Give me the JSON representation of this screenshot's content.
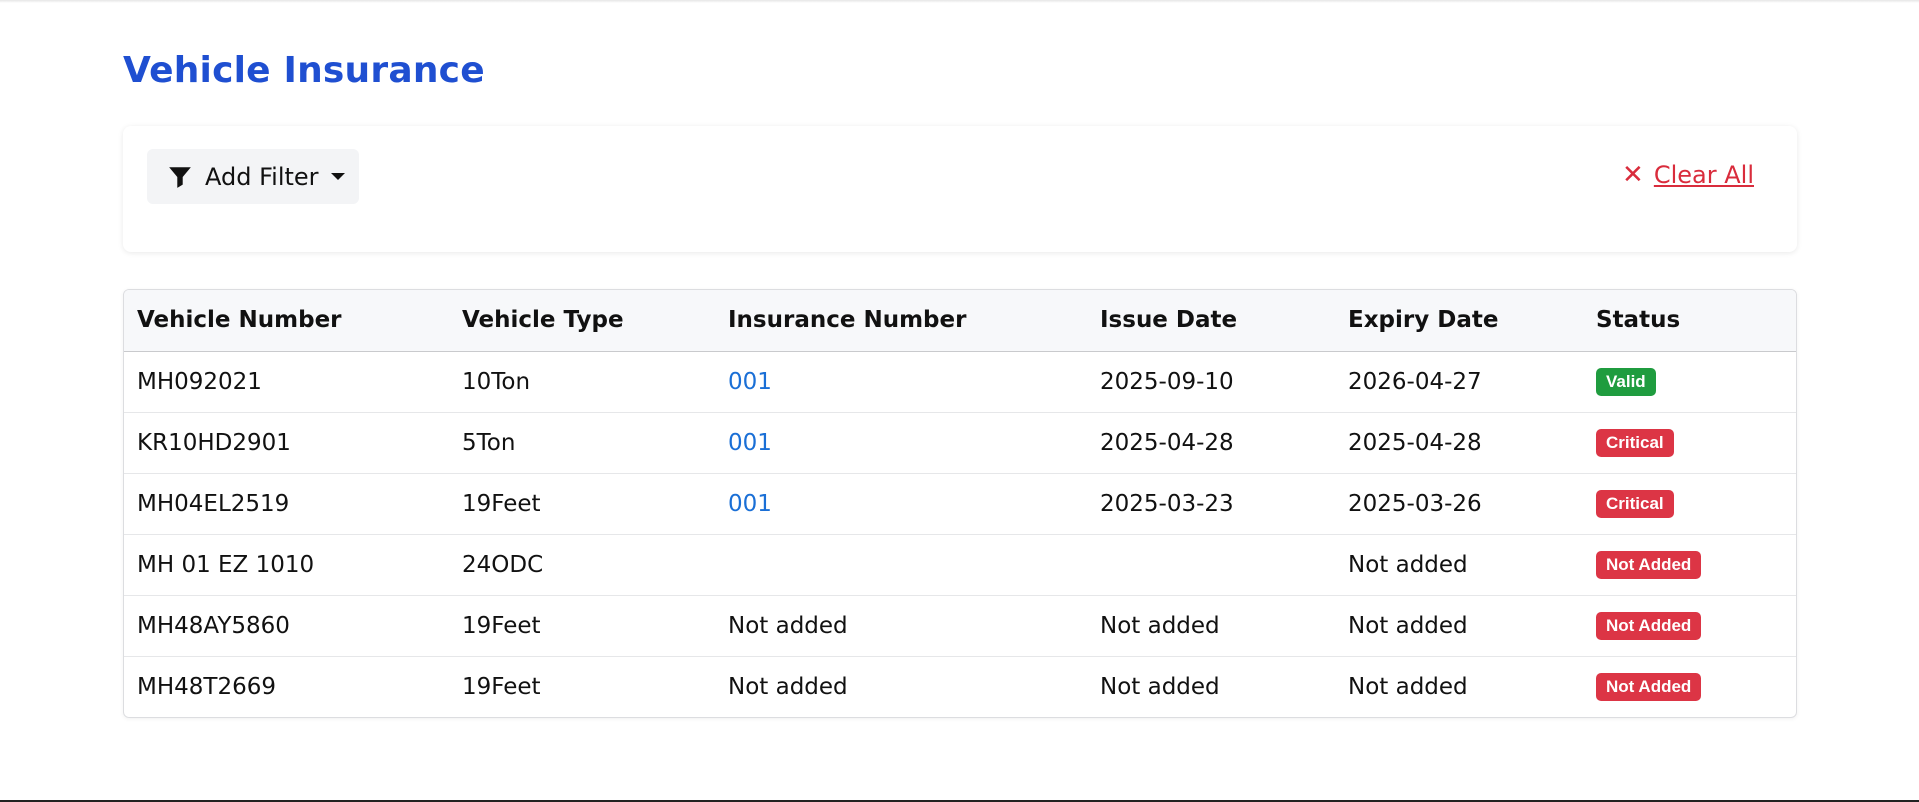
{
  "page": {
    "title": "Vehicle Insurance"
  },
  "filters": {
    "add_filter_label": "Add Filter",
    "clear_all_label": "Clear All",
    "clear_icon": "close-icon",
    "filter_icon": "funnel-icon"
  },
  "table": {
    "headers": [
      "Vehicle Number",
      "Vehicle Type",
      "Insurance Number",
      "Issue Date",
      "Expiry Date",
      "Status"
    ],
    "rows": [
      {
        "vehicle_number": "MH092021",
        "vehicle_type": "10Ton",
        "insurance_number": "001",
        "issue_date": "2025-09-10",
        "expiry_date": "2026-04-27",
        "status": "Valid"
      },
      {
        "vehicle_number": "KR10HD2901",
        "vehicle_type": "5Ton",
        "insurance_number": "001",
        "issue_date": "2025-04-28",
        "expiry_date": "2025-04-28",
        "status": "Critical"
      },
      {
        "vehicle_number": "MH04EL2519",
        "vehicle_type": "19Feet",
        "insurance_number": "001",
        "issue_date": "2025-03-23",
        "expiry_date": "2025-03-26",
        "status": "Critical"
      },
      {
        "vehicle_number": "MH 01 EZ 1010",
        "vehicle_type": "24ODC",
        "insurance_number": "",
        "issue_date": "",
        "expiry_date": "Not added",
        "status": "Not Added"
      },
      {
        "vehicle_number": "MH48AY5860",
        "vehicle_type": "19Feet",
        "insurance_number": "Not added",
        "issue_date": "Not added",
        "expiry_date": "Not added",
        "status": "Not Added"
      },
      {
        "vehicle_number": "MH48T2669",
        "vehicle_type": "19Feet",
        "insurance_number": "Not added",
        "issue_date": "Not added",
        "expiry_date": "Not added",
        "status": "Not Added"
      }
    ]
  },
  "colors": {
    "title": "#1f4fd1",
    "link": "#1a6fd6",
    "valid": "#1f9c3f",
    "danger": "#dc3545"
  }
}
